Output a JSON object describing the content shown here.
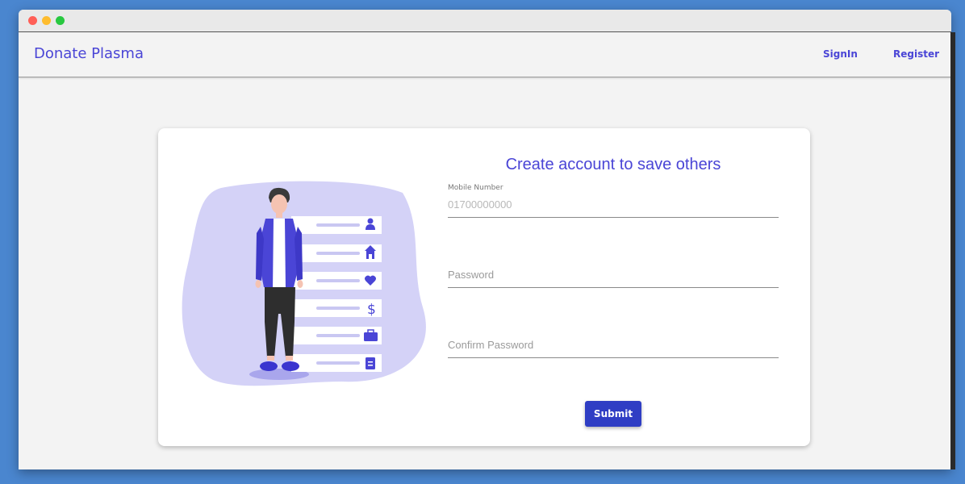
{
  "app": {
    "brand": "Donate Plasma",
    "nav": {
      "signin_label": "SignIn",
      "register_label": "Register"
    }
  },
  "form": {
    "title": "Create account to save others",
    "mobile": {
      "label": "Mobile Number",
      "placeholder": "01700000000"
    },
    "password": {
      "placeholder": "Password"
    },
    "confirm_password": {
      "placeholder": "Confirm Password"
    },
    "submit_label": "Submit"
  },
  "icons": {
    "list": [
      "user-icon",
      "home-icon",
      "heart-icon",
      "dollar-icon",
      "briefcase-icon",
      "document-icon"
    ]
  },
  "colors": {
    "accent": "#4a45d6",
    "button": "#2f3ec4",
    "blob": "#d4d2f7",
    "background": "#4a86cf"
  }
}
